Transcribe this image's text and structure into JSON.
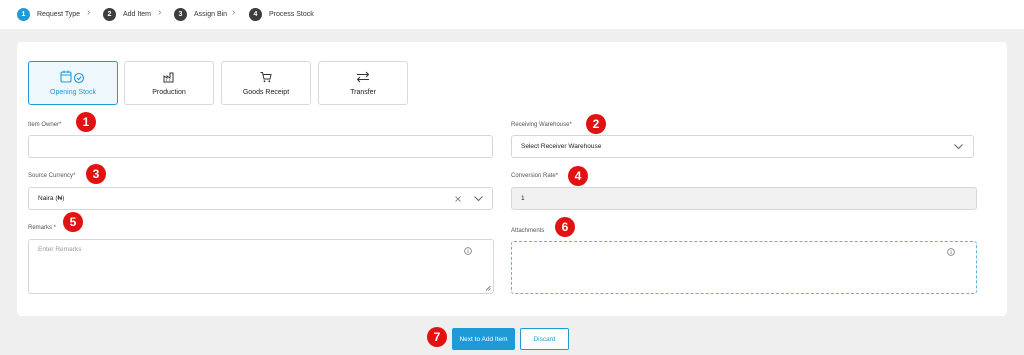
{
  "stepper": {
    "steps": [
      {
        "num": "1",
        "label": "Request Type"
      },
      {
        "num": "2",
        "label": "Add Item"
      },
      {
        "num": "3",
        "label": "Assign Bin"
      },
      {
        "num": "4",
        "label": "Process Stock"
      }
    ],
    "separator": "›"
  },
  "request_types": [
    {
      "label": "Opening Stock",
      "icon": "calendar-check-icon",
      "selected": true
    },
    {
      "label": "Production",
      "icon": "factory-icon",
      "selected": false
    },
    {
      "label": "Goods Receipt",
      "icon": "cart-icon",
      "selected": false
    },
    {
      "label": "Transfer",
      "icon": "transfer-arrows-icon",
      "selected": false
    }
  ],
  "form": {
    "item_owner": {
      "label": "Item Owner*",
      "value": ""
    },
    "receiving_warehouse": {
      "label": "Receiving Warehouse*",
      "value": "Select Receiver Warehouse"
    },
    "source_currency": {
      "label": "Source Currency*",
      "value": "Naira (₦)"
    },
    "conversion_rate": {
      "label": "Conversion Rate*",
      "value": "1"
    },
    "remarks": {
      "label": "Remarks *",
      "placeholder": "Enter Remarks"
    },
    "attachments": {
      "label": "Attachments"
    }
  },
  "annotations": [
    "1",
    "2",
    "3",
    "4",
    "5",
    "6",
    "7"
  ],
  "actions": {
    "next_label": "Next to Add Item",
    "discard_label": "Discard"
  },
  "colors": {
    "accent": "#1e9bd7",
    "badge": "#e21212",
    "step_inactive": "#3d3d3d"
  }
}
